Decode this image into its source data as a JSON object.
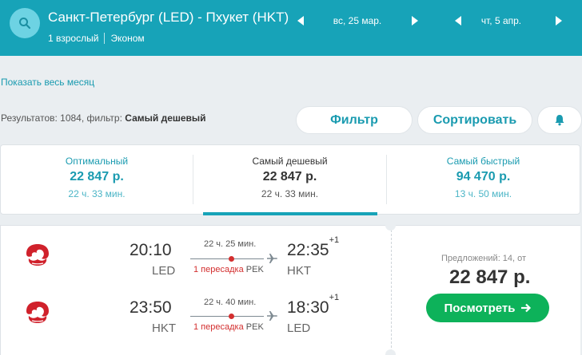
{
  "header": {
    "route": "Санкт-Петербург (LED) - Пхукет (HKT)",
    "passengers": "1 взрослый",
    "cabin": "Эконом",
    "depart_date": "вс, 25 мар.",
    "return_date": "чт, 5 апр.",
    "icons": {
      "search": "search-icon",
      "prev": "chevron-left-icon",
      "next": "chevron-right-icon"
    }
  },
  "links": {
    "show_month": "Показать весь месяц"
  },
  "results": {
    "prefix": "Результатов: 1084, фильтр:",
    "filter_value": "Самый дешевый"
  },
  "toolbar": {
    "filter_label": "Фильтр",
    "sort_label": "Сортировать",
    "alert_icon": "bell-icon"
  },
  "sort_tabs": [
    {
      "label": "Оптимальный",
      "price": "22 847 р.",
      "duration": "22 ч. 33 мин."
    },
    {
      "label": "Самый дешевый",
      "price": "22 847 р.",
      "duration": "22 ч. 33 мин.",
      "active": true
    },
    {
      "label": "Самый быстрый",
      "price": "94 470 р.",
      "duration": "13 ч. 50 мин."
    }
  ],
  "offer": {
    "airline_logo": "hainan-airlines-logo",
    "segments": [
      {
        "dep_time": "20:10",
        "dep_code": "LED",
        "arr_time": "22:35",
        "arr_day": "+1",
        "arr_code": "HKT",
        "duration": "22 ч. 25 мин.",
        "stops": "1 пересадка",
        "via": "PEK"
      },
      {
        "dep_time": "23:50",
        "dep_code": "HKT",
        "arr_time": "18:30",
        "arr_day": "+1",
        "arr_code": "LED",
        "duration": "22 ч. 40 мин.",
        "stops": "1 пересадка",
        "via": "PEK"
      }
    ],
    "offers_count": "Предложений: 14, от",
    "price": "22 847 р.",
    "view_button": "Посмотреть",
    "view_button_icon": "arrow-right-icon"
  },
  "colors": {
    "header_bg": "#17a3b8",
    "accent": "#1a9bb0",
    "cta": "#0db25a",
    "stop_red": "#d32f2f"
  }
}
